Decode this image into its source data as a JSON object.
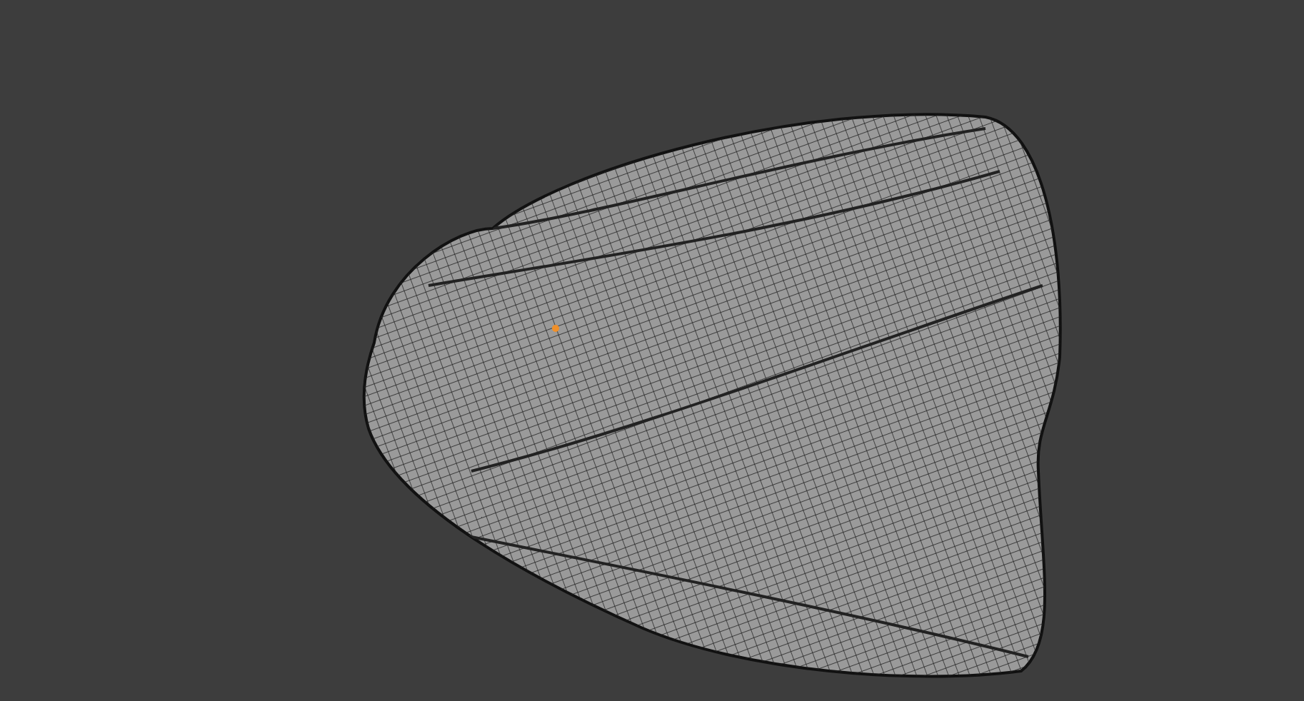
{
  "viewport": {
    "object": {
      "kind": "mesh",
      "origin_shown": true
    }
  }
}
